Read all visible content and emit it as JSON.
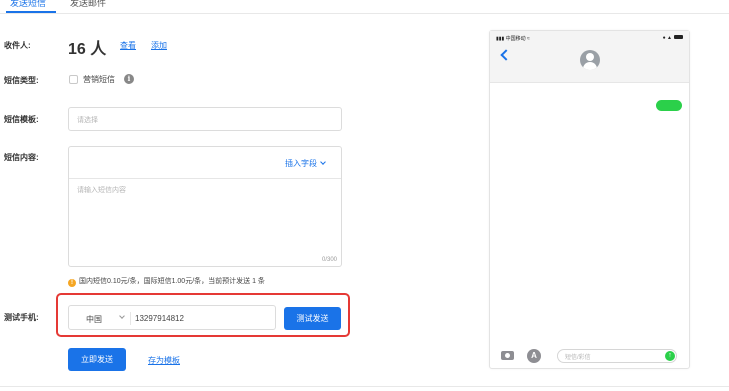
{
  "tabs": [
    {
      "label": "发送短信",
      "active": true
    },
    {
      "label": "发送邮件",
      "active": false
    }
  ],
  "form": {
    "recipient_label": "收件人:",
    "recipient_count": "16 人",
    "view_link": "查看",
    "add_link": "添加",
    "sms_type_label": "短信类型:",
    "marketing_label": "营销短信",
    "template_label": "短信模板:",
    "template_placeholder": "请选择",
    "content_label": "短信内容:",
    "insert_field": "插入字段",
    "content_placeholder": "请输入短信内容",
    "char_counter": "0/300",
    "pricing_note": "国内短信0.10元/条，国际短信1.00元/条，当前预计发送 1 条",
    "test_phone_label": "测试手机:",
    "country": "中国",
    "phone_number": "13297914812",
    "test_send_button": "测试发送",
    "send_now_button": "立即发送",
    "save_template_link": "存为模板"
  },
  "phone_preview": {
    "carrier": "中国移动",
    "message_placeholder": "短信/彩信"
  },
  "colors": {
    "primary": "#1a73e8",
    "highlight_border": "#e53935",
    "bubble": "#2bd04a",
    "warning": "#f5a623"
  }
}
